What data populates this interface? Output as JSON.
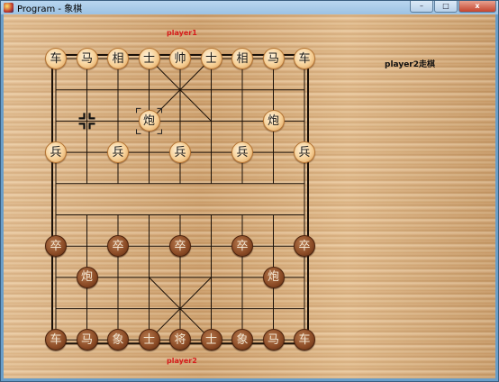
{
  "window": {
    "title": "Program - 象棋",
    "minimize_label": "–",
    "maximize_label": "□",
    "close_label": "x"
  },
  "player_top_label": "player1",
  "player_bottom_label": "player2",
  "turn_status": "player2走棋",
  "board": {
    "files": 9,
    "ranks": 10
  },
  "selected_piece": {
    "file": 3,
    "rank": 2
  },
  "move_marker": {
    "file": 1,
    "rank": 2
  },
  "pieces": [
    {
      "char": "车",
      "side": "light",
      "file": 0,
      "rank": 0
    },
    {
      "char": "马",
      "side": "light",
      "file": 1,
      "rank": 0
    },
    {
      "char": "相",
      "side": "light",
      "file": 2,
      "rank": 0
    },
    {
      "char": "士",
      "side": "light",
      "file": 3,
      "rank": 0
    },
    {
      "char": "帅",
      "side": "light",
      "file": 4,
      "rank": 0
    },
    {
      "char": "士",
      "side": "light",
      "file": 5,
      "rank": 0
    },
    {
      "char": "相",
      "side": "light",
      "file": 6,
      "rank": 0
    },
    {
      "char": "马",
      "side": "light",
      "file": 7,
      "rank": 0
    },
    {
      "char": "车",
      "side": "light",
      "file": 8,
      "rank": 0
    },
    {
      "char": "炮",
      "side": "light",
      "file": 3,
      "rank": 2
    },
    {
      "char": "炮",
      "side": "light",
      "file": 7,
      "rank": 2
    },
    {
      "char": "兵",
      "side": "light",
      "file": 0,
      "rank": 3
    },
    {
      "char": "兵",
      "side": "light",
      "file": 2,
      "rank": 3
    },
    {
      "char": "兵",
      "side": "light",
      "file": 4,
      "rank": 3
    },
    {
      "char": "兵",
      "side": "light",
      "file": 6,
      "rank": 3
    },
    {
      "char": "兵",
      "side": "light",
      "file": 8,
      "rank": 3
    },
    {
      "char": "卒",
      "side": "dark",
      "file": 0,
      "rank": 6
    },
    {
      "char": "卒",
      "side": "dark",
      "file": 2,
      "rank": 6
    },
    {
      "char": "卒",
      "side": "dark",
      "file": 4,
      "rank": 6
    },
    {
      "char": "卒",
      "side": "dark",
      "file": 6,
      "rank": 6
    },
    {
      "char": "卒",
      "side": "dark",
      "file": 8,
      "rank": 6
    },
    {
      "char": "炮",
      "side": "dark",
      "file": 1,
      "rank": 7
    },
    {
      "char": "炮",
      "side": "dark",
      "file": 7,
      "rank": 7
    },
    {
      "char": "车",
      "side": "dark",
      "file": 0,
      "rank": 9
    },
    {
      "char": "马",
      "side": "dark",
      "file": 1,
      "rank": 9
    },
    {
      "char": "象",
      "side": "dark",
      "file": 2,
      "rank": 9
    },
    {
      "char": "士",
      "side": "dark",
      "file": 3,
      "rank": 9
    },
    {
      "char": "将",
      "side": "dark",
      "file": 4,
      "rank": 9
    },
    {
      "char": "士",
      "side": "dark",
      "file": 5,
      "rank": 9
    },
    {
      "char": "象",
      "side": "dark",
      "file": 6,
      "rank": 9
    },
    {
      "char": "马",
      "side": "dark",
      "file": 7,
      "rank": 9
    },
    {
      "char": "车",
      "side": "dark",
      "file": 8,
      "rank": 9
    }
  ]
}
